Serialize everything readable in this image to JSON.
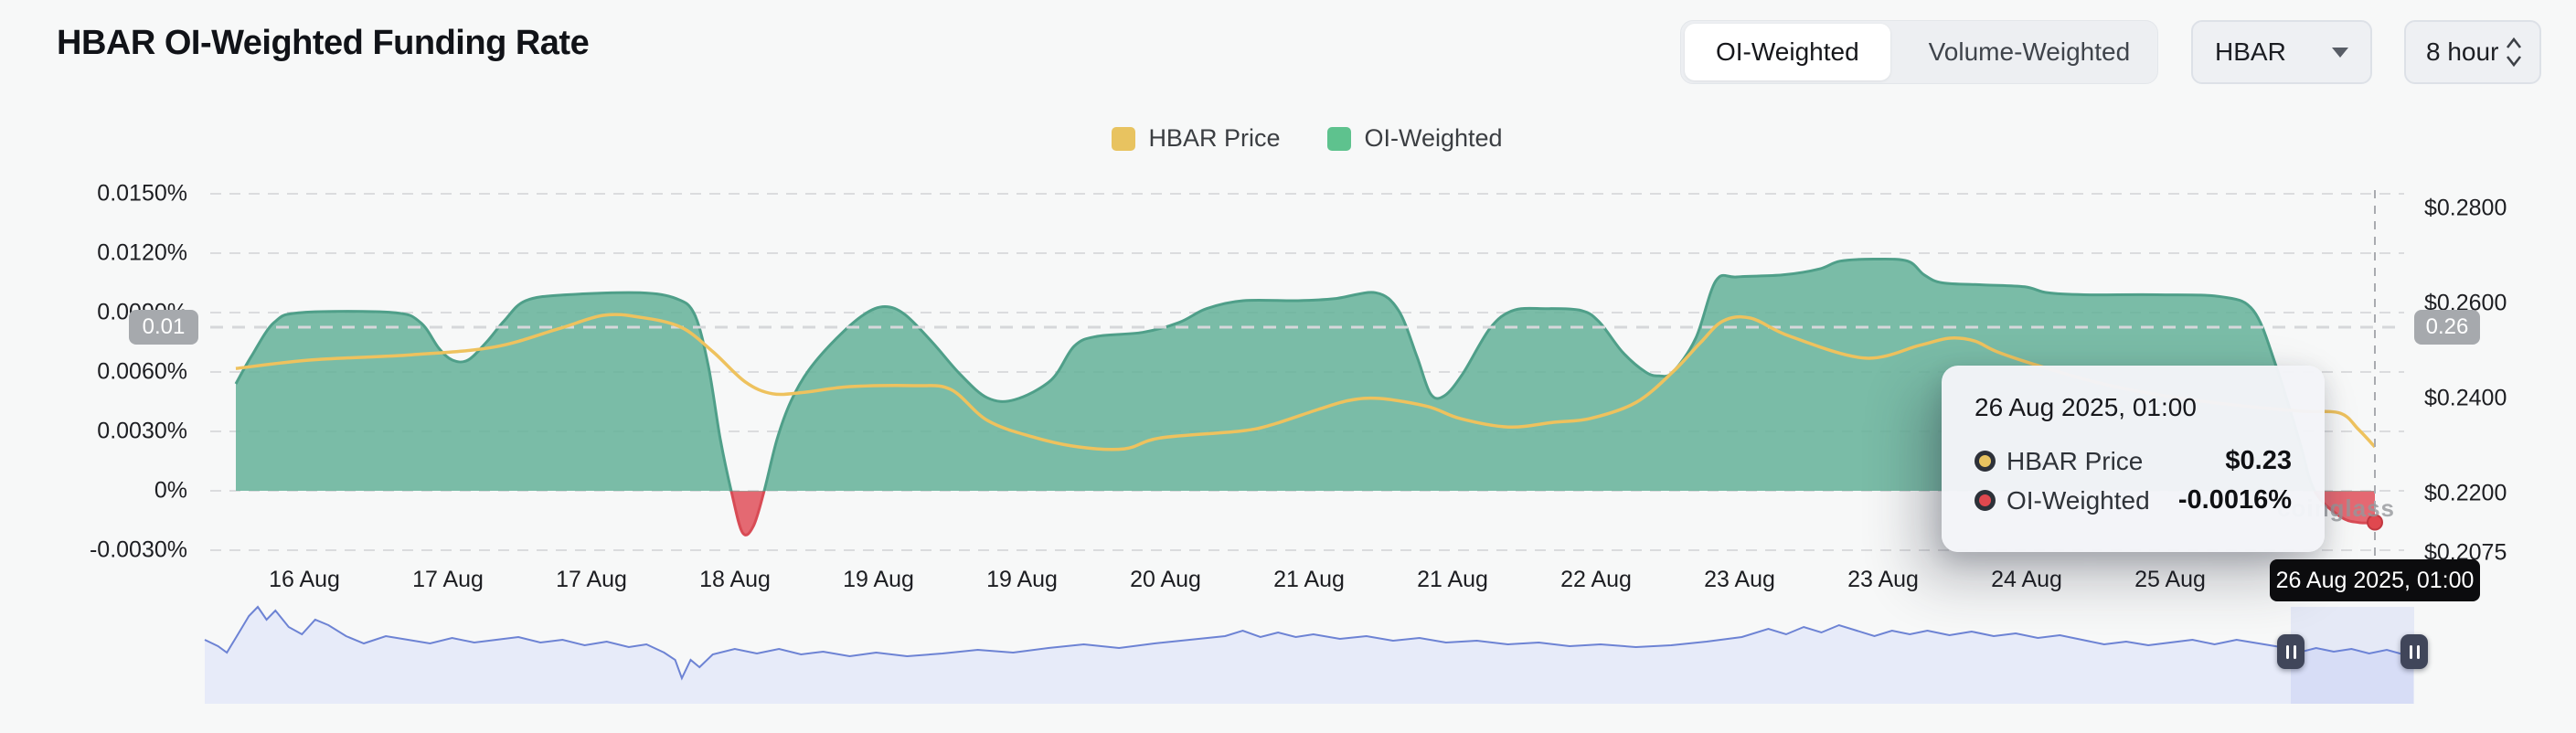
{
  "header": {
    "title": "HBAR OI-Weighted Funding Rate"
  },
  "controls": {
    "segmented": {
      "options": [
        "OI-Weighted",
        "Volume-Weighted"
      ],
      "active": "OI-Weighted"
    },
    "symbol_select": {
      "value": "HBAR"
    },
    "interval_select": {
      "value": "8 hour"
    }
  },
  "legend": [
    {
      "label": "HBAR Price",
      "color": "#e8c360"
    },
    {
      "label": "OI-Weighted",
      "color": "#5ec28e"
    }
  ],
  "watermark": {
    "text": "coinglass"
  },
  "pills": {
    "left": "0.01",
    "right": "0.26"
  },
  "crosshair": {
    "x_label": "26 Aug 2025, 01:00"
  },
  "tooltip": {
    "title": "26 Aug 2025, 01:00",
    "rows": [
      {
        "label": "HBAR Price",
        "value": "$0.23",
        "marker_color": "#e8c360"
      },
      {
        "label": "OI-Weighted",
        "value": "-0.0016%",
        "marker_color": "#e0484f"
      }
    ]
  },
  "chart_data": {
    "type": "area",
    "title": "HBAR OI-Weighted Funding Rate",
    "x_ticks": [
      "16 Aug",
      "17 Aug",
      "17 Aug",
      "18 Aug",
      "19 Aug",
      "19 Aug",
      "20 Aug",
      "21 Aug",
      "21 Aug",
      "22 Aug",
      "23 Aug",
      "23 Aug",
      "24 Aug",
      "25 Aug"
    ],
    "left_axis": {
      "unit": "%",
      "tick_labels": [
        "0.0150%",
        "0.0120%",
        "0.0090%",
        "0.0060%",
        "0.0030%",
        "0%",
        "-0.0030%"
      ],
      "tick_values": [
        0.015,
        0.012,
        0.009,
        0.006,
        0.003,
        0,
        -0.003
      ],
      "grid": "dashed"
    },
    "right_axis": {
      "unit": "$",
      "tick_labels": [
        "$0.2800",
        "$0.2600",
        "$0.2400",
        "$0.2200",
        "$0.2075"
      ],
      "tick_values": [
        0.28,
        0.26,
        0.24,
        0.22,
        0.2075
      ]
    },
    "legend_position": "top-center",
    "series": [
      {
        "name": "OI-Weighted",
        "kind": "area",
        "axis": "left",
        "unit": "percent",
        "color_positive": "#64b299",
        "color_negative": "#e0505a",
        "points": [
          [
            0.0,
            0.0054
          ],
          [
            0.0073,
            0.0068
          ],
          [
            0.0179,
            0.0085
          ],
          [
            0.0308,
            0.009
          ],
          [
            0.0735,
            0.009
          ],
          [
            0.0863,
            0.0085
          ],
          [
            0.0949,
            0.0072
          ],
          [
            0.1013,
            0.0066
          ],
          [
            0.1085,
            0.0066
          ],
          [
            0.1171,
            0.0075
          ],
          [
            0.1256,
            0.0086
          ],
          [
            0.1355,
            0.0096
          ],
          [
            0.1547,
            0.0099
          ],
          [
            0.1889,
            0.01
          ],
          [
            0.206,
            0.0097
          ],
          [
            0.2145,
            0.0089
          ],
          [
            0.2209,
            0.0063
          ],
          [
            0.2265,
            0.0026
          ],
          [
            0.2316,
            0.0
          ],
          [
            0.2368,
            -0.0021
          ],
          [
            0.2419,
            -0.0018
          ],
          [
            0.247,
            0.0
          ],
          [
            0.253,
            0.0026
          ],
          [
            0.2594,
            0.0045
          ],
          [
            0.2679,
            0.0061
          ],
          [
            0.2808,
            0.0077
          ],
          [
            0.2936,
            0.0089
          ],
          [
            0.3034,
            0.0093
          ],
          [
            0.3128,
            0.0089
          ],
          [
            0.3256,
            0.0075
          ],
          [
            0.3385,
            0.0059
          ],
          [
            0.3513,
            0.0047
          ],
          [
            0.3641,
            0.0046
          ],
          [
            0.3812,
            0.0056
          ],
          [
            0.3919,
            0.0073
          ],
          [
            0.4026,
            0.0078
          ],
          [
            0.4239,
            0.008
          ],
          [
            0.441,
            0.0085
          ],
          [
            0.4538,
            0.0092
          ],
          [
            0.4709,
            0.0096
          ],
          [
            0.4966,
            0.0096
          ],
          [
            0.5137,
            0.0097
          ],
          [
            0.5329,
            0.01
          ],
          [
            0.5436,
            0.0091
          ],
          [
            0.5521,
            0.0068
          ],
          [
            0.5585,
            0.0049
          ],
          [
            0.565,
            0.0048
          ],
          [
            0.5735,
            0.0059
          ],
          [
            0.5863,
            0.0082
          ],
          [
            0.597,
            0.0091
          ],
          [
            0.612,
            0.0092
          ],
          [
            0.6291,
            0.0091
          ],
          [
            0.6376,
            0.0085
          ],
          [
            0.6483,
            0.007
          ],
          [
            0.659,
            0.006
          ],
          [
            0.6654,
            0.0058
          ],
          [
            0.6718,
            0.006
          ],
          [
            0.6825,
            0.0077
          ],
          [
            0.6919,
            0.0106
          ],
          [
            0.7017,
            0.0108
          ],
          [
            0.7231,
            0.0109
          ],
          [
            0.7402,
            0.0112
          ],
          [
            0.75,
            0.0116
          ],
          [
            0.7658,
            0.0117
          ],
          [
            0.7816,
            0.0116
          ],
          [
            0.7893,
            0.0109
          ],
          [
            0.7979,
            0.0105
          ],
          [
            0.8171,
            0.0104
          ],
          [
            0.8363,
            0.0103
          ],
          [
            0.847,
            0.01
          ],
          [
            0.8641,
            0.0099
          ],
          [
            0.8983,
            0.0099
          ],
          [
            0.9282,
            0.0098
          ],
          [
            0.9432,
            0.0091
          ],
          [
            0.9538,
            0.0063
          ],
          [
            0.9645,
            0.0026
          ],
          [
            0.9718,
            0.0
          ],
          [
            0.9838,
            -0.0013
          ],
          [
            0.9923,
            -0.0016
          ],
          [
            1.0,
            -0.0016
          ]
        ],
        "last_point": {
          "x_label": "26 Aug 2025, 01:00",
          "value_pct": -0.0016
        }
      },
      {
        "name": "HBAR Price",
        "kind": "line",
        "axis": "right",
        "unit": "usd",
        "color": "#eec25e",
        "points": [
          [
            0.0,
            0.2463
          ],
          [
            0.035,
            0.2481
          ],
          [
            0.0821,
            0.2492
          ],
          [
            0.1205,
            0.2508
          ],
          [
            0.1504,
            0.2546
          ],
          [
            0.1718,
            0.2575
          ],
          [
            0.1889,
            0.2571
          ],
          [
            0.2081,
            0.255
          ],
          [
            0.2231,
            0.2498
          ],
          [
            0.2381,
            0.2435
          ],
          [
            0.2509,
            0.241
          ],
          [
            0.2658,
            0.2413
          ],
          [
            0.2872,
            0.2425
          ],
          [
            0.3171,
            0.2427
          ],
          [
            0.3342,
            0.2419
          ],
          [
            0.3513,
            0.2354
          ],
          [
            0.3726,
            0.2319
          ],
          [
            0.394,
            0.2298
          ],
          [
            0.4154,
            0.2294
          ],
          [
            0.4321,
            0.2317
          ],
          [
            0.4688,
            0.2331
          ],
          [
            0.4838,
            0.2344
          ],
          [
            0.506,
            0.2377
          ],
          [
            0.5205,
            0.2396
          ],
          [
            0.535,
            0.24
          ],
          [
            0.5573,
            0.2383
          ],
          [
            0.5722,
            0.2358
          ],
          [
            0.5949,
            0.234
          ],
          [
            0.6162,
            0.235
          ],
          [
            0.6333,
            0.2358
          ],
          [
            0.6547,
            0.2392
          ],
          [
            0.6718,
            0.2456
          ],
          [
            0.6846,
            0.2517
          ],
          [
            0.6953,
            0.2563
          ],
          [
            0.7082,
            0.2569
          ],
          [
            0.7265,
            0.2531
          ],
          [
            0.7615,
            0.2485
          ],
          [
            0.7872,
            0.2512
          ],
          [
            0.8013,
            0.2527
          ],
          [
            0.8128,
            0.2521
          ],
          [
            0.8235,
            0.2498
          ],
          [
            0.8427,
            0.2469
          ],
          [
            0.8726,
            0.2431
          ],
          [
            0.9068,
            0.2402
          ],
          [
            0.941,
            0.2383
          ],
          [
            0.9667,
            0.2373
          ],
          [
            0.9838,
            0.2369
          ],
          [
            0.9923,
            0.2335
          ],
          [
            1.0,
            0.2298
          ]
        ],
        "last_point": {
          "x_label": "26 Aug 2025, 01:00",
          "value_usd": 0.23
        }
      }
    ],
    "navigator": {
      "color_line": "#6d83d4",
      "color_fill": "#e4e9f8",
      "values": [
        [
          0.0,
          0.52
        ],
        [
          0.006,
          0.45
        ],
        [
          0.01,
          0.38
        ],
        [
          0.016,
          0.62
        ],
        [
          0.02,
          0.78
        ],
        [
          0.024,
          0.88
        ],
        [
          0.028,
          0.74
        ],
        [
          0.032,
          0.84
        ],
        [
          0.038,
          0.66
        ],
        [
          0.044,
          0.58
        ],
        [
          0.05,
          0.74
        ],
        [
          0.056,
          0.68
        ],
        [
          0.064,
          0.56
        ],
        [
          0.072,
          0.48
        ],
        [
          0.082,
          0.56
        ],
        [
          0.092,
          0.52
        ],
        [
          0.102,
          0.48
        ],
        [
          0.112,
          0.54
        ],
        [
          0.122,
          0.49
        ],
        [
          0.132,
          0.52
        ],
        [
          0.142,
          0.55
        ],
        [
          0.152,
          0.49
        ],
        [
          0.162,
          0.52
        ],
        [
          0.172,
          0.46
        ],
        [
          0.182,
          0.5
        ],
        [
          0.192,
          0.44
        ],
        [
          0.2,
          0.47
        ],
        [
          0.208,
          0.38
        ],
        [
          0.213,
          0.3
        ],
        [
          0.216,
          0.1
        ],
        [
          0.22,
          0.3
        ],
        [
          0.224,
          0.22
        ],
        [
          0.23,
          0.36
        ],
        [
          0.24,
          0.42
        ],
        [
          0.25,
          0.37
        ],
        [
          0.26,
          0.42
        ],
        [
          0.27,
          0.36
        ],
        [
          0.28,
          0.39
        ],
        [
          0.292,
          0.34
        ],
        [
          0.304,
          0.38
        ],
        [
          0.318,
          0.34
        ],
        [
          0.334,
          0.37
        ],
        [
          0.35,
          0.41
        ],
        [
          0.366,
          0.38
        ],
        [
          0.382,
          0.43
        ],
        [
          0.398,
          0.47
        ],
        [
          0.414,
          0.43
        ],
        [
          0.43,
          0.48
        ],
        [
          0.446,
          0.52
        ],
        [
          0.462,
          0.56
        ],
        [
          0.47,
          0.62
        ],
        [
          0.478,
          0.55
        ],
        [
          0.486,
          0.6
        ],
        [
          0.494,
          0.55
        ],
        [
          0.502,
          0.58
        ],
        [
          0.514,
          0.53
        ],
        [
          0.526,
          0.56
        ],
        [
          0.538,
          0.51
        ],
        [
          0.55,
          0.54
        ],
        [
          0.562,
          0.49
        ],
        [
          0.576,
          0.51
        ],
        [
          0.59,
          0.47
        ],
        [
          0.604,
          0.49
        ],
        [
          0.618,
          0.45
        ],
        [
          0.632,
          0.47
        ],
        [
          0.648,
          0.44
        ],
        [
          0.664,
          0.46
        ],
        [
          0.68,
          0.5
        ],
        [
          0.696,
          0.55
        ],
        [
          0.708,
          0.64
        ],
        [
          0.716,
          0.58
        ],
        [
          0.724,
          0.66
        ],
        [
          0.732,
          0.6
        ],
        [
          0.74,
          0.68
        ],
        [
          0.748,
          0.62
        ],
        [
          0.756,
          0.56
        ],
        [
          0.764,
          0.62
        ],
        [
          0.772,
          0.58
        ],
        [
          0.78,
          0.62
        ],
        [
          0.79,
          0.57
        ],
        [
          0.8,
          0.61
        ],
        [
          0.81,
          0.56
        ],
        [
          0.82,
          0.59
        ],
        [
          0.83,
          0.54
        ],
        [
          0.84,
          0.57
        ],
        [
          0.85,
          0.52
        ],
        [
          0.86,
          0.47
        ],
        [
          0.87,
          0.5
        ],
        [
          0.88,
          0.46
        ],
        [
          0.89,
          0.49
        ],
        [
          0.9,
          0.52
        ],
        [
          0.91,
          0.47
        ],
        [
          0.92,
          0.52
        ],
        [
          0.93,
          0.48
        ],
        [
          0.94,
          0.44
        ],
        [
          0.948,
          0.38
        ],
        [
          0.956,
          0.43
        ],
        [
          0.964,
          0.39
        ],
        [
          0.972,
          0.42
        ],
        [
          0.98,
          0.37
        ],
        [
          0.988,
          0.41
        ],
        [
          1.0,
          0.33
        ]
      ],
      "selected_range_note": "right-end window between two drag handles"
    }
  }
}
